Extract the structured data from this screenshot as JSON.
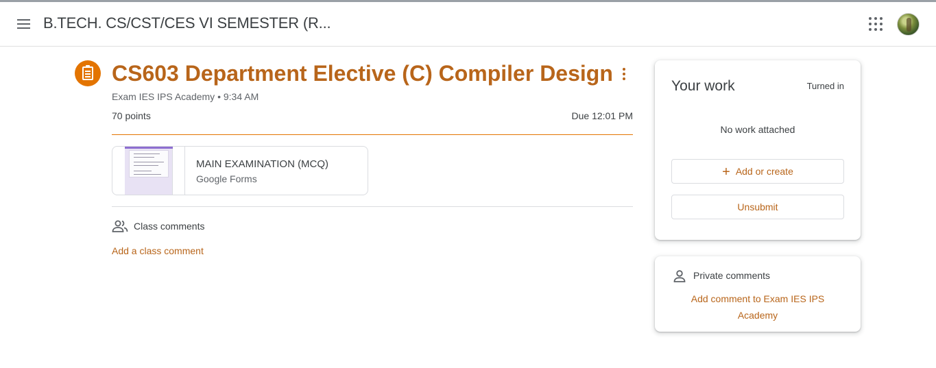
{
  "header": {
    "title": "B.TECH. CS/CST/CES VI SEMESTER (R..."
  },
  "assignment": {
    "title": "CS603 Department Elective (C) Compiler Design",
    "author": "Exam IES IPS Academy",
    "separator": "•",
    "time": "9:34 AM",
    "points": "70 points",
    "due": "Due 12:01 PM",
    "attachment": {
      "title": "MAIN EXAMINATION (MCQ)",
      "type": "Google Forms"
    }
  },
  "class_comments": {
    "label": "Class comments",
    "add_label": "Add a class comment"
  },
  "your_work": {
    "title": "Your work",
    "status": "Turned in",
    "empty": "No work attached",
    "add_icon": "+",
    "add_label": "Add or create",
    "unsubmit_label": "Unsubmit"
  },
  "private_comments": {
    "label": "Private comments",
    "add_label": "Add comment to Exam IES IPS Academy"
  },
  "colors": {
    "accent": "#b8651a",
    "icon_bg": "#e37400"
  },
  "icons": {
    "menu": "menu-icon",
    "apps": "apps-grid-icon",
    "assignment": "assignment-icon",
    "more": "more-vertical-icon",
    "people": "people-icon",
    "person": "person-icon",
    "add": "plus-icon"
  }
}
